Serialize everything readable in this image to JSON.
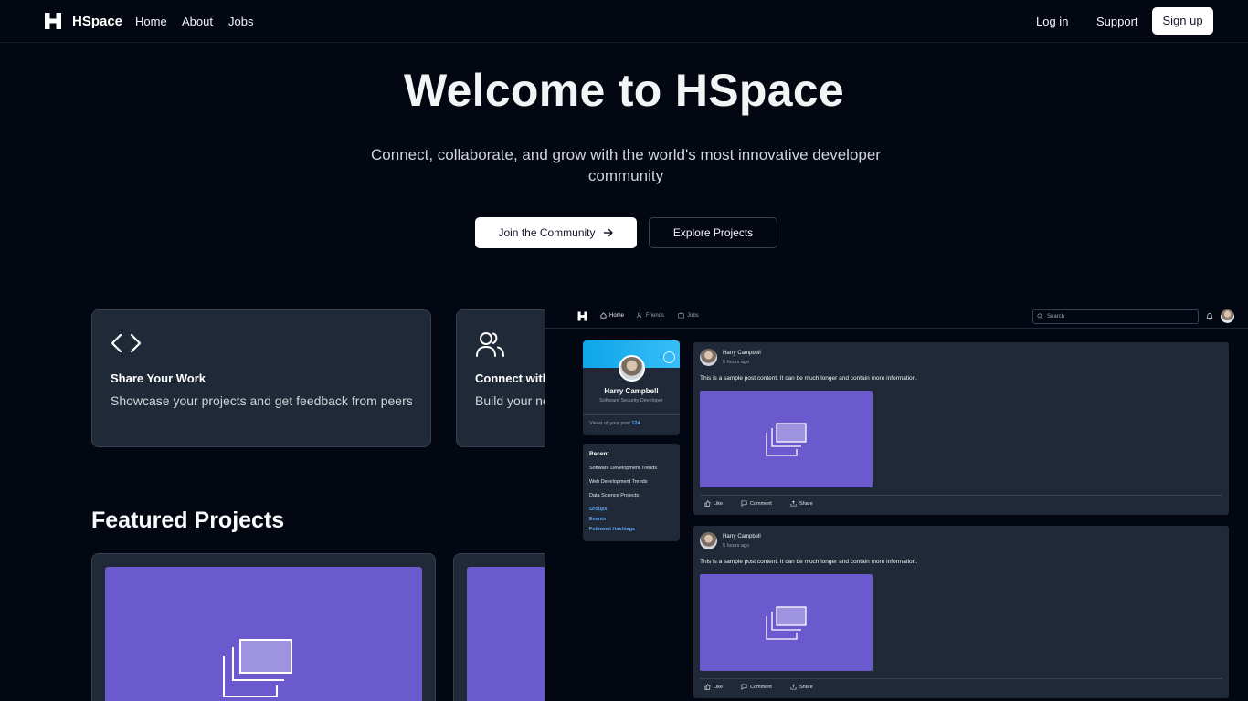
{
  "nav": {
    "brand": "HSpace",
    "links": [
      "Home",
      "About",
      "Jobs"
    ],
    "login": "Log in",
    "support": "Support",
    "signup": "Sign up"
  },
  "hero": {
    "title": "Welcome to HSpace",
    "subtitle": "Connect, collaborate, and grow with the world's most innovative developer community",
    "join_button": "Join the Community",
    "explore_button": "Explore Projects"
  },
  "features": [
    {
      "icon": "code-icon",
      "title": "Share Your Work",
      "desc": "Showcase your projects and get feedback from peers"
    },
    {
      "icon": "users-icon",
      "title": "Connect with",
      "desc": "Build your ne"
    }
  ],
  "featured": {
    "title": "Featured Projects"
  },
  "preview": {
    "nav": {
      "links": [
        "Home",
        "Friends",
        "Jobs"
      ],
      "search_placeholder": "Search"
    },
    "profile": {
      "name": "Harry Campbell",
      "role": "Software Security Developer",
      "views_label": "Views of your post",
      "views_count": "124"
    },
    "recent": {
      "title": "Recent",
      "items": [
        "Software Development Trends",
        "Web Development Trends",
        "Data Science Projects"
      ],
      "links": [
        "Groups",
        "Events",
        "Followed Hashtags"
      ]
    },
    "posts": [
      {
        "author": "Harry Campbell",
        "time": "5 hours ago",
        "text": "This is a sample post content. It can be much longer and contain more information."
      },
      {
        "author": "Harry Campbell",
        "time": "5 hours ago",
        "text": "This is a sample post content. It can be much longer and contain more information."
      }
    ],
    "actions": {
      "like": "Like",
      "comment": "Comment",
      "share": "Share"
    }
  },
  "colors": {
    "background": "#030712",
    "card": "#1f2937",
    "placeholder_image": "#6a5acd",
    "link_accent": "#60a5fa"
  }
}
